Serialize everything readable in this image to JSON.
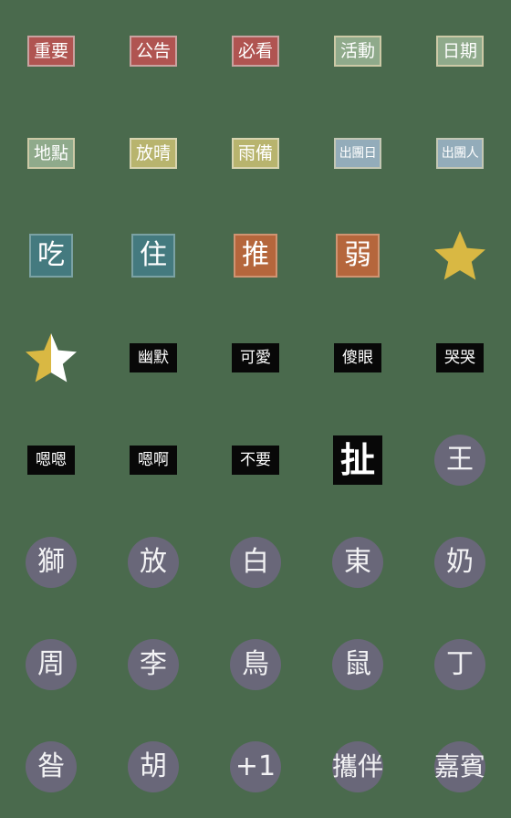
{
  "page": {
    "background_color": "#4a6a4d",
    "columns": 5,
    "rows": 8,
    "total_stickers": 40
  },
  "palette": {
    "background_green": "#4a6a4d",
    "badge_red": "#b05451",
    "badge_green": "#8faa8b",
    "badge_khaki": "#b8b46e",
    "badge_blue": "#93acba",
    "square_teal": "#447a7f",
    "square_orange": "#b5663c",
    "black": "#080808",
    "circle_gray": "#696779",
    "star_gold": "#d9b843",
    "star_empty": "#ffffff",
    "border_light": "#d8d4b0",
    "text_white": "#ffffff"
  },
  "stickers": [
    {
      "id": "s1",
      "label": "重要",
      "shape": "badge",
      "bg": "#b05451",
      "border": "#c9a2a0",
      "text_color": "#ffffff"
    },
    {
      "id": "s2",
      "label": "公告",
      "shape": "badge",
      "bg": "#b05451",
      "border": "#c9a2a0",
      "text_color": "#ffffff"
    },
    {
      "id": "s3",
      "label": "必看",
      "shape": "badge",
      "bg": "#b05451",
      "border": "#c9a2a0",
      "text_color": "#ffffff"
    },
    {
      "id": "s4",
      "label": "活動",
      "shape": "badge",
      "bg": "#8faa8b",
      "border": "#ccc9a6",
      "text_color": "#ffffff"
    },
    {
      "id": "s5",
      "label": "日期",
      "shape": "badge",
      "bg": "#8faa8b",
      "border": "#ccc9a6",
      "text_color": "#ffffff"
    },
    {
      "id": "s6",
      "label": "地點",
      "shape": "badge",
      "bg": "#8faa8b",
      "border": "#ccc9a6",
      "text_color": "#ffffff"
    },
    {
      "id": "s7",
      "label": "放晴",
      "shape": "badge",
      "bg": "#b8b46e",
      "border": "#d8d4b0",
      "text_color": "#ffffff"
    },
    {
      "id": "s8",
      "label": "雨備",
      "shape": "badge",
      "bg": "#b8b46e",
      "border": "#d8d4b0",
      "text_color": "#ffffff"
    },
    {
      "id": "s9",
      "label": "出團日",
      "shape": "badge-small",
      "bg": "#93acba",
      "border": "#c3c7b4",
      "text_color": "#ffffff"
    },
    {
      "id": "s10",
      "label": "出團人",
      "shape": "badge-small",
      "bg": "#93acba",
      "border": "#c3c7b4",
      "text_color": "#ffffff"
    },
    {
      "id": "s11",
      "label": "吃",
      "shape": "square",
      "bg": "#447a7f",
      "border": "#7ba2a4",
      "text_color": "#ffffff"
    },
    {
      "id": "s12",
      "label": "住",
      "shape": "square",
      "bg": "#447a7f",
      "border": "#7ba2a4",
      "text_color": "#ffffff"
    },
    {
      "id": "s13",
      "label": "推",
      "shape": "square",
      "bg": "#b5663c",
      "border": "#cf9472",
      "text_color": "#ffffff"
    },
    {
      "id": "s14",
      "label": "弱",
      "shape": "square",
      "bg": "#b5663c",
      "border": "#cf9472",
      "text_color": "#ffffff"
    },
    {
      "id": "s15",
      "label": "",
      "shape": "star-full",
      "bg": "#d9b843",
      "border": "",
      "text_color": ""
    },
    {
      "id": "s16",
      "label": "",
      "shape": "star-half",
      "bg": "#d9b843",
      "border": "",
      "text_color": ""
    },
    {
      "id": "s17",
      "label": "幽默",
      "shape": "black-badge",
      "bg": "#080808",
      "border": "",
      "text_color": "#ffffff"
    },
    {
      "id": "s18",
      "label": "可愛",
      "shape": "black-badge",
      "bg": "#080808",
      "border": "",
      "text_color": "#ffffff"
    },
    {
      "id": "s19",
      "label": "傻眼",
      "shape": "black-badge",
      "bg": "#080808",
      "border": "",
      "text_color": "#ffffff"
    },
    {
      "id": "s20",
      "label": "哭哭",
      "shape": "black-badge",
      "bg": "#080808",
      "border": "",
      "text_color": "#ffffff"
    },
    {
      "id": "s21",
      "label": "嗯嗯",
      "shape": "black-badge",
      "bg": "#080808",
      "border": "",
      "text_color": "#ffffff"
    },
    {
      "id": "s22",
      "label": "嗯啊",
      "shape": "black-badge",
      "bg": "#080808",
      "border": "",
      "text_color": "#ffffff"
    },
    {
      "id": "s23",
      "label": "不要",
      "shape": "black-badge",
      "bg": "#080808",
      "border": "",
      "text_color": "#ffffff"
    },
    {
      "id": "s24",
      "label": "扯",
      "shape": "black-big",
      "bg": "#080808",
      "border": "",
      "text_color": "#ffffff"
    },
    {
      "id": "s25",
      "label": "王",
      "shape": "circle",
      "bg": "#696779",
      "border": "",
      "text_color": "#f2f2f4"
    },
    {
      "id": "s26",
      "label": "獅",
      "shape": "circle",
      "bg": "#696779",
      "border": "",
      "text_color": "#f2f2f4"
    },
    {
      "id": "s27",
      "label": "放",
      "shape": "circle",
      "bg": "#696779",
      "border": "",
      "text_color": "#f2f2f4"
    },
    {
      "id": "s28",
      "label": "白",
      "shape": "circle",
      "bg": "#696779",
      "border": "",
      "text_color": "#f2f2f4"
    },
    {
      "id": "s29",
      "label": "東",
      "shape": "circle",
      "bg": "#696779",
      "border": "",
      "text_color": "#f2f2f4"
    },
    {
      "id": "s30",
      "label": "奶",
      "shape": "circle",
      "bg": "#696779",
      "border": "",
      "text_color": "#f2f2f4"
    },
    {
      "id": "s31",
      "label": "周",
      "shape": "circle",
      "bg": "#696779",
      "border": "",
      "text_color": "#f2f2f4"
    },
    {
      "id": "s32",
      "label": "李",
      "shape": "circle",
      "bg": "#696779",
      "border": "",
      "text_color": "#f2f2f4"
    },
    {
      "id": "s33",
      "label": "鳥",
      "shape": "circle",
      "bg": "#696779",
      "border": "",
      "text_color": "#f2f2f4"
    },
    {
      "id": "s34",
      "label": "鼠",
      "shape": "circle",
      "bg": "#696779",
      "border": "",
      "text_color": "#f2f2f4"
    },
    {
      "id": "s35",
      "label": "丁",
      "shape": "circle",
      "bg": "#696779",
      "border": "",
      "text_color": "#f2f2f4"
    },
    {
      "id": "s36",
      "label": "昝",
      "shape": "circle",
      "bg": "#696779",
      "border": "",
      "text_color": "#f2f2f4"
    },
    {
      "id": "s37",
      "label": "胡",
      "shape": "circle",
      "bg": "#696779",
      "border": "",
      "text_color": "#f2f2f4"
    },
    {
      "id": "s38",
      "label": "+1",
      "shape": "circle",
      "bg": "#696779",
      "border": "",
      "text_color": "#f2f2f4"
    },
    {
      "id": "s39",
      "label": "攜伴",
      "shape": "circle-wide",
      "bg": "#696779",
      "border": "",
      "text_color": "#f2f2f4"
    },
    {
      "id": "s40",
      "label": "嘉賓",
      "shape": "circle-wide",
      "bg": "#696779",
      "border": "",
      "text_color": "#f2f2f4"
    }
  ]
}
